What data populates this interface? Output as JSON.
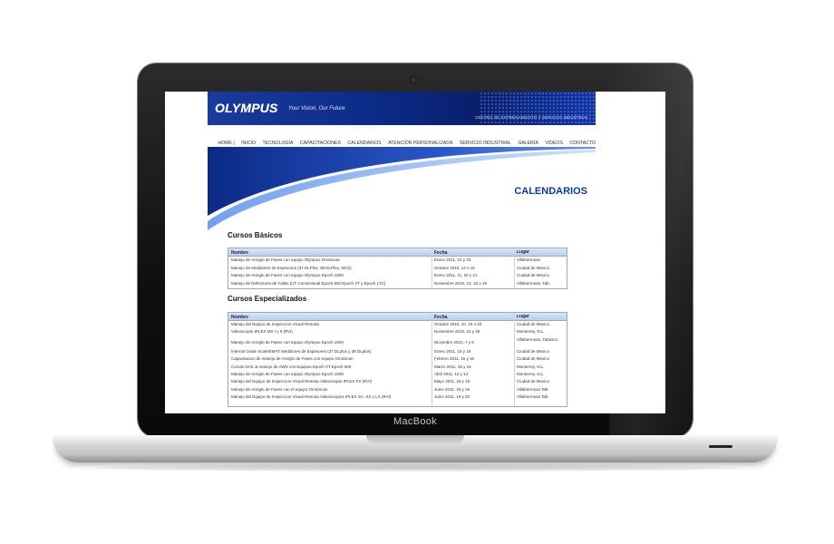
{
  "device": {
    "brand": "MacBook"
  },
  "site": {
    "logo": "OLYMPUS",
    "logo_sub": "Your Vision, Our Future",
    "tagline": "CENTRO DE ENTRENAMIENTO Y SERVICIO INDUSTRIAL",
    "nav": [
      "HOME |",
      "INICIO",
      "TECNOLOGÍA",
      "CAPACITACIONES",
      "CALENDARIOS",
      "ATENCIÓN PERSONALIZADA",
      "SERVICIO INDUSTRIAL",
      "GALERÍA",
      "VIDEOS",
      "CONTACTO"
    ],
    "page_title": "CALENDARIOS"
  },
  "basicos": {
    "title": "Cursos Básicos",
    "headers": [
      "Nombre",
      "Fecha",
      "Lugar"
    ],
    "rows": [
      [
        "Manejo de Arreglo de Fases con equipo Olympus Omniscan",
        "Enero 2011, 22 y 23",
        "Villahermosa"
      ],
      [
        "Manejo de Medidores de Espesores (37 DLPlus, 38 DLPlus, MG2)",
        "Octubre 2010, 14 o 15",
        "Ciudad de Mexico"
      ],
      [
        "Manejo de Arreglo de Fases con equipo Olympus Epoch 1000",
        "Enero 2011, 11, 20 y 21",
        "Cuidad de Mexico"
      ],
      [
        "Manejo de Defectores de Fallas (UT Convesional Epoch 600 Epoch XT y Epoch LTC)",
        "Noviembre 2010, 10, 18 o 19",
        "Villahermosa, Tab."
      ]
    ]
  },
  "especializados": {
    "title": "Cursos Especializados",
    "headers": [
      "Nombre",
      "Fecha",
      "Lugar"
    ],
    "rows": [
      [
        "Manejo del Equipo de Inspeccion Visual Remota",
        "Octubre 2010, 10, 19 o 20",
        "Ciudad de Mexico"
      ],
      [
        "Videoscopio IPLEX MX I y II (RVI)",
        "Noviembre 2010, 24 y 25",
        "Monterrey, N.L."
      ],
      [
        "Manejo de Arreglo de Fases con equipo Olympus Epoch 1000",
        "Diciembre 2010, 7 y 8",
        "Villahermosa, Tabasco"
      ],
      [
        "Internal Oxide Scale/EMAT Medidores de Espesores (37 DLplus y 38 DLplus)",
        "Enero 2011, 18 y 19",
        "Ciudad de Mexico"
      ],
      [
        "Capacitacion de manejo de Arreglo de Fases con equipo Omniscan",
        "Febrero 2011, 15 y 16",
        "Ciudad de Mexico"
      ],
      [
        "Curvas DAC & manejo de AWS con Equipos Epoch XT Epoch 600",
        "Marzo 2011, 15 y 16",
        "Monterrey, N.L."
      ],
      [
        "Manejo de Arreglo de Fases con equipo Olympus Epoch 1000",
        "Abril 2011, 12 y 14",
        "Monterrey, N.L."
      ],
      [
        "Manejo del Equipo de Inspeccion Visual Remota Videoscopio IPLEX FX (RVI)",
        "Mayo 2011, 18 y 19",
        "Ciudad de Mexico"
      ],
      [
        "Manejo de Arreglo de Fases con el equipo OmniScan",
        "Junio 2011, 15 y 16",
        "Villahermosa Tab."
      ],
      [
        "Manejo del Equipo de Inspeccion Visual Remota Videoscopios IPLEX SA, SX y LX (RVI)",
        "Junio 2011, 19 y 20",
        "Villahermosa Tab."
      ]
    ]
  },
  "colors": {
    "brand_blue": "#0a3aa3",
    "header_blue": "#0b2a86",
    "table_header": "#c7dbf4"
  }
}
